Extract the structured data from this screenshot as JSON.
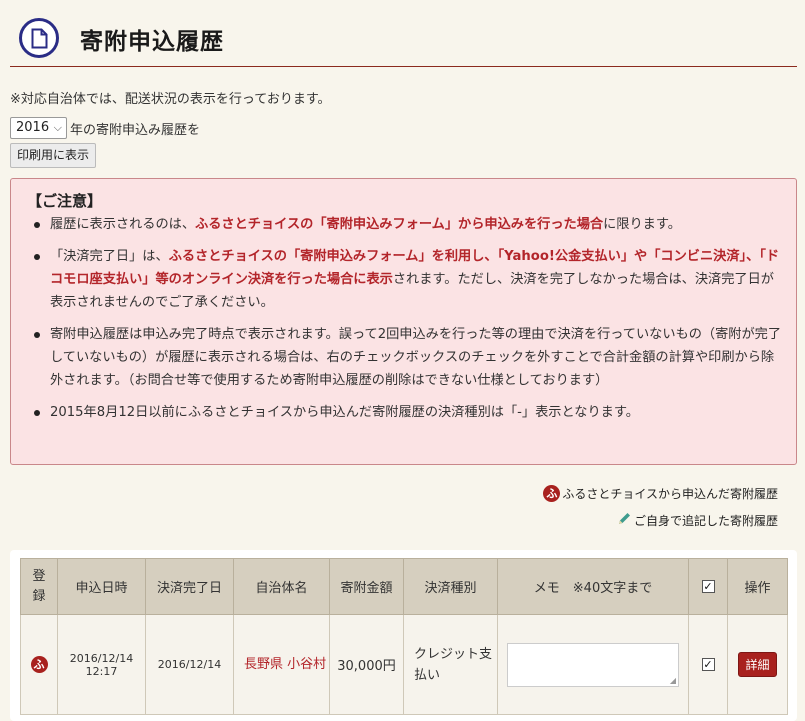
{
  "header": {
    "title": "寄附申込履歴"
  },
  "notice": "※対応自治体では、配送状況の表示を行っております。",
  "year_filter": {
    "selected": "2016",
    "label": "年の寄附申込み履歴を"
  },
  "print_button": "印刷用に表示",
  "caution": {
    "title": "【ご注意】",
    "items": [
      {
        "parts": [
          {
            "t": "履歴に表示されるのは、"
          },
          {
            "t": "ふるさとチョイスの「寄附申込みフォーム」から申込みを行った場合",
            "em": true
          },
          {
            "t": "に限ります。"
          }
        ]
      },
      {
        "parts": [
          {
            "t": "「決済完了日」は、"
          },
          {
            "t": "ふるさとチョイスの「寄附申込みフォーム」を利用し、「Yahoo!公金支払い」や「コンビニ決済」、「ドコモロ座支払い」等のオンライン決済を行った場合に表示",
            "em": true
          },
          {
            "t": "されます。ただし、決済を完了しなかった場合は、決済完了日が表示されませんのでご了承ください。"
          }
        ]
      },
      {
        "parts": [
          {
            "t": "寄附申込履歴は申込み完了時点で表示されます。誤って2回申込みを行った等の理由で決済を行っていないもの（寄附が完了していないもの）が履歴に表示される場合は、右のチェックボックスのチェックを外すことで合計金額の計算や印刷から除外されます。（お問合せ等で使用するため寄附申込履歴の削除はできない仕様としております）"
          }
        ]
      },
      {
        "parts": [
          {
            "t": "2015年8月12日以前にふるさとチョイスから申込んだ寄附履歴の決済種別は「-」表示となります。"
          }
        ]
      }
    ]
  },
  "legend": {
    "furusato_badge": "ふ",
    "furusato_label": "ふるさとチョイスから申込んだ寄附履歴",
    "self_label": "ご自身で追記した寄附履歴"
  },
  "table": {
    "headers": {
      "register": "登録",
      "apply_date": "申込日時",
      "settle_date": "決済完了日",
      "municipality": "自治体名",
      "amount": "寄附金額",
      "payment_type": "決済種別",
      "memo": "メモ　※40文字まで",
      "action": "操作"
    },
    "rows": [
      {
        "badge": "ふ",
        "apply_date": "2016/12/14",
        "apply_time": "12:17",
        "settle_date": "2016/12/14",
        "municipality": "長野県 小谷村",
        "amount": "30,000円",
        "payment_type": "クレジット支払い",
        "checked": true,
        "detail": "詳細"
      }
    ]
  },
  "colors": {
    "accent": "#a8211e",
    "brand_icon": "#2a2c86",
    "caution_bg": "#fbe3e4"
  },
  "icons": {
    "header": "document-icon",
    "legend_self": "pencil-icon",
    "check": "✓"
  }
}
